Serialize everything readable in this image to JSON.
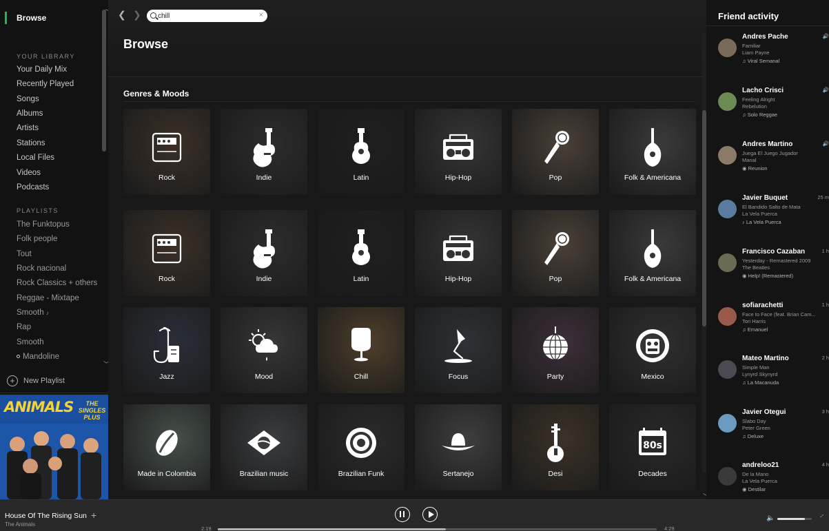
{
  "sidebar": {
    "browse_label": "Browse",
    "library_header": "YOUR LIBRARY",
    "library_items": [
      "Your Daily Mix",
      "Recently Played",
      "Songs",
      "Albums",
      "Artists",
      "Stations",
      "Local Files",
      "Videos",
      "Podcasts"
    ],
    "playlists_header": "PLAYLISTS",
    "playlists": [
      "The Funktopus",
      "Folk people",
      "Tout",
      "Rock nacional",
      "Rock Classics + others",
      "Reggae - Mixtape",
      "Smooth",
      "Rap",
      "Smooth",
      "Mandoline"
    ],
    "new_playlist_label": "New Playlist",
    "album_art": {
      "title": "ANIMALS",
      "prefix": "THE",
      "subtitle": "THE SINGLES PLUS"
    }
  },
  "topbar": {
    "back_icon": "chevron-left-icon",
    "forward_icon": "chevron-right-icon",
    "search_value": "chill",
    "clear_icon": "close-icon"
  },
  "main": {
    "page_title": "Browse",
    "section_title": "Genres & Moods",
    "tiles": [
      {
        "label": "Rock",
        "icon": "amp-icon",
        "bg": "#3b3028"
      },
      {
        "label": "Indie",
        "icon": "electric-guitar-icon",
        "bg": "#2c2c2c"
      },
      {
        "label": "Latin",
        "icon": "acoustic-guitar-icon",
        "bg": "#1f1f1f"
      },
      {
        "label": "Hip-Hop",
        "icon": "boombox-icon",
        "bg": "#353535"
      },
      {
        "label": "Pop",
        "icon": "microphone-icon",
        "bg": "#4a4038"
      },
      {
        "label": "Folk & Americana",
        "icon": "mandolin-icon",
        "bg": "#3a3a3a"
      },
      {
        "label": "Rock",
        "icon": "amp-icon",
        "bg": "#3b3028"
      },
      {
        "label": "Indie",
        "icon": "electric-guitar-icon",
        "bg": "#2c2c2c"
      },
      {
        "label": "Latin",
        "icon": "acoustic-guitar-icon",
        "bg": "#1f1f1f"
      },
      {
        "label": "Hip-Hop",
        "icon": "boombox-icon",
        "bg": "#353535"
      },
      {
        "label": "Pop",
        "icon": "microphone-icon",
        "bg": "#4a4038"
      },
      {
        "label": "Folk & Americana",
        "icon": "mandolin-icon",
        "bg": "#3a3a3a"
      },
      {
        "label": "Jazz",
        "icon": "saxophone-icon",
        "bg": "#2a2e38"
      },
      {
        "label": "Mood",
        "icon": "weather-icon",
        "bg": "#363636"
      },
      {
        "label": "Chill",
        "icon": "egg-chair-icon",
        "bg": "#4e3f2b"
      },
      {
        "label": "Focus",
        "icon": "desk-lamp-icon",
        "bg": "#2e3236"
      },
      {
        "label": "Party",
        "icon": "disco-ball-icon",
        "bg": "#3d2e3a"
      },
      {
        "label": "Mexico",
        "icon": "aztec-mask-icon",
        "bg": "#2f2f2f"
      },
      {
        "label": "Made in Colombia",
        "icon": "coffee-bean-icon",
        "bg": "#46504a"
      },
      {
        "label": "Brazilian music",
        "icon": "brazil-flag-icon",
        "bg": "#3a3c3e"
      },
      {
        "label": "Brazilian Funk",
        "icon": "speaker-icon",
        "bg": "#2a2a2a"
      },
      {
        "label": "Sertanejo",
        "icon": "cowboy-hat-icon",
        "bg": "#3e3e3e"
      },
      {
        "label": "Desi",
        "icon": "sitar-icon",
        "bg": "#3c3228"
      },
      {
        "label": "Decades",
        "icon": "calendar-80s-icon",
        "bg": "#282828"
      }
    ]
  },
  "friends": {
    "header": "Friend activity",
    "items": [
      {
        "name": "Andres Pache",
        "track": "Familiar",
        "artist": "Liam Payne",
        "context": "Viral Semanal",
        "context_icon": "note-icon",
        "time": "",
        "playing": true,
        "avatar_color": "#7a6a5a"
      },
      {
        "name": "Lacho Crisci",
        "track": "Feeling Alright",
        "artist": "Rebelution",
        "context": "Solo Reggae",
        "context_icon": "note-icon",
        "time": "",
        "playing": true,
        "avatar_color": "#6b8a55"
      },
      {
        "name": "Andres Martino",
        "track": "Juega El Juego Jugador",
        "artist": "Manal",
        "context": "Reunion",
        "context_icon": "radio-icon",
        "time": "",
        "playing": true,
        "avatar_color": "#8a7a6a"
      },
      {
        "name": "Javier Buquet",
        "track": "El Bandido Salto de Mata",
        "artist": "La Vela Puerca",
        "context": "La Vela Puerca",
        "context_icon": "artist-icon",
        "time": "25 m",
        "playing": false,
        "avatar_color": "#5a7aa0"
      },
      {
        "name": "Francisco Cazaban",
        "track": "Yesterday - Remastered 2009",
        "artist": "The Beatles",
        "context": "Help! (Remastered)",
        "context_icon": "album-icon",
        "time": "1 h",
        "playing": false,
        "avatar_color": "#6a6a55"
      },
      {
        "name": "sofiarachetti",
        "track": "Face to Face (feat. Brian Cam...",
        "artist": "Tori Harris",
        "context": "Emanuel",
        "context_icon": "note-icon",
        "time": "1 h",
        "playing": false,
        "avatar_color": "#9a5a4a"
      },
      {
        "name": "Mateo Martino",
        "track": "Simple Man",
        "artist": "Lynyrd Skynyrd",
        "context": "La Macanuda",
        "context_icon": "note-icon",
        "time": "2 h",
        "playing": false,
        "avatar_color": "#4a4a55"
      },
      {
        "name": "Javier Otegui",
        "track": "Slabo Day",
        "artist": "Peter Green",
        "context": "Deluxe",
        "context_icon": "note-icon",
        "time": "3 h",
        "playing": false,
        "avatar_color": "#6a9ac0"
      },
      {
        "name": "andreloo21",
        "track": "De la Mano",
        "artist": "La Vela Puerca",
        "context": "Destilar",
        "context_icon": "album-icon",
        "time": "4 h",
        "playing": false,
        "avatar_color": "#3a3a3a"
      }
    ]
  },
  "player": {
    "track": "House Of The Rising Sun",
    "artist": "The Animals",
    "elapsed": "2:19",
    "total": "4:29",
    "progress": 0.52,
    "volume": 0.8
  },
  "colors": {
    "accent": "#1db954",
    "background": "#121212",
    "main": "#181818"
  }
}
